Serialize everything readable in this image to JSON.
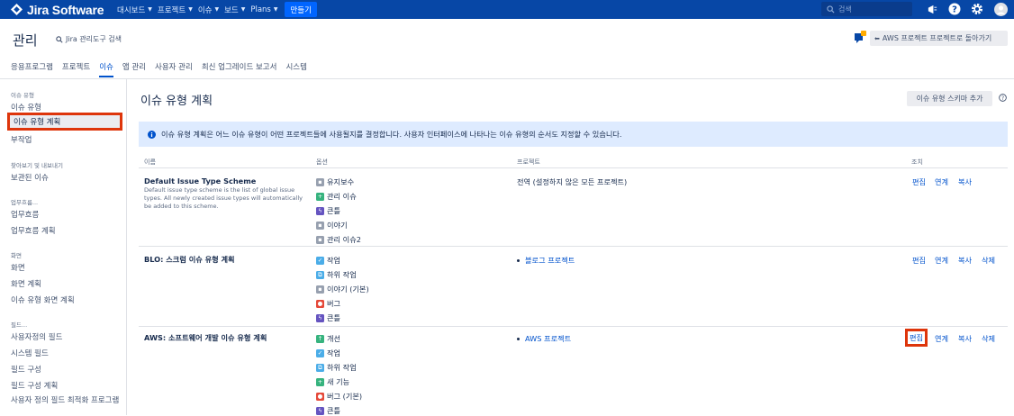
{
  "topnav": {
    "logo": "Jira Software",
    "items": [
      "대시보드",
      "프로젝트",
      "이슈",
      "보드",
      "Plans"
    ],
    "create": "만들기",
    "search_placeholder": "검색"
  },
  "header": {
    "title": "관리",
    "search": "Jira 관리도구 검색",
    "back_button": "AWS 프로젝트 프로젝트로 돌아가기",
    "tabs": [
      "응용프로그램",
      "프로젝트",
      "이슈",
      "앱 관리",
      "사용자 관리",
      "최신 업그레이드 보고서",
      "시스템"
    ]
  },
  "sidebar": {
    "sections": [
      {
        "heading": "이슈 유형",
        "items": [
          "이슈 유형",
          "이슈 유형 계획",
          "부작업"
        ]
      },
      {
        "heading": "찾아보기 및 내보내기",
        "items": [
          "보관된 이슈"
        ]
      },
      {
        "heading": "업무흐름...",
        "items": [
          "업무흐름",
          "업무흐름 계획"
        ]
      },
      {
        "heading": "화면",
        "items": [
          "화면",
          "화면 계획",
          "이슈 유형 화면 계획"
        ]
      },
      {
        "heading": "필드...",
        "items": [
          "사용자정의 필드",
          "시스템 필드",
          "필드 구성",
          "필드 구성 계획",
          "사용자 정의 필드 최적화 프로그램"
        ]
      }
    ]
  },
  "main": {
    "title": "이슈 유형 계획",
    "add_button": "이슈 유형 스키마 추가",
    "info": "이슈 유형 계획은 어느 이슈 유형이 어떤 프로젝트들에 사용될지를 결정합니다. 사용자 인터페이스에 나타나는 이슈 유형의 순서도 지정할 수 있습니다.",
    "columns": [
      "이름",
      "옵션",
      "프로젝트",
      "조치"
    ],
    "schemes": [
      {
        "name": "Default Issue Type Scheme",
        "description": "Default issue type scheme is the list of global issue types. All newly created issue types will automatically be added to this scheme.",
        "options": [
          {
            "label": "유지보수",
            "icon": "gray-square-icon"
          },
          {
            "label": "관리 이슈",
            "icon": "green-plus-icon"
          },
          {
            "label": "큰틀",
            "icon": "purple-epic-icon"
          },
          {
            "label": "이야기",
            "icon": "gray-square-icon"
          },
          {
            "label": "관리 이슈2",
            "icon": "gray-square-icon"
          }
        ],
        "project": "전역 (설정하지 않은 모든 프로젝트)",
        "actions": [
          "편집",
          "연계",
          "복사"
        ]
      },
      {
        "name": "BLO: 스크럼 이슈 유형 계획",
        "options": [
          {
            "label": "작업",
            "icon": "blue-check-icon"
          },
          {
            "label": "하위 작업",
            "icon": "blue-subtask-icon"
          },
          {
            "label": "이야기 (기본)",
            "icon": "gray-square-icon"
          },
          {
            "label": "버그",
            "icon": "red-bug-icon"
          },
          {
            "label": "큰틀",
            "icon": "purple-epic-icon"
          }
        ],
        "project": "블로그 프로젝트",
        "actions": [
          "편집",
          "연계",
          "복사",
          "삭제"
        ]
      },
      {
        "name": "AWS: 소프트웨어 개발 이슈 유형 계획",
        "options": [
          {
            "label": "개선",
            "icon": "green-arrow-icon"
          },
          {
            "label": "작업",
            "icon": "blue-check-icon"
          },
          {
            "label": "하위 작업",
            "icon": "blue-subtask-icon"
          },
          {
            "label": "새 기능",
            "icon": "green-plus-icon"
          },
          {
            "label": "버그 (기본)",
            "icon": "red-bug-icon"
          },
          {
            "label": "큰틀",
            "icon": "purple-epic-icon"
          }
        ],
        "project": "AWS 프로젝트",
        "actions": [
          "편집",
          "연계",
          "복사",
          "삭제"
        ]
      }
    ]
  }
}
